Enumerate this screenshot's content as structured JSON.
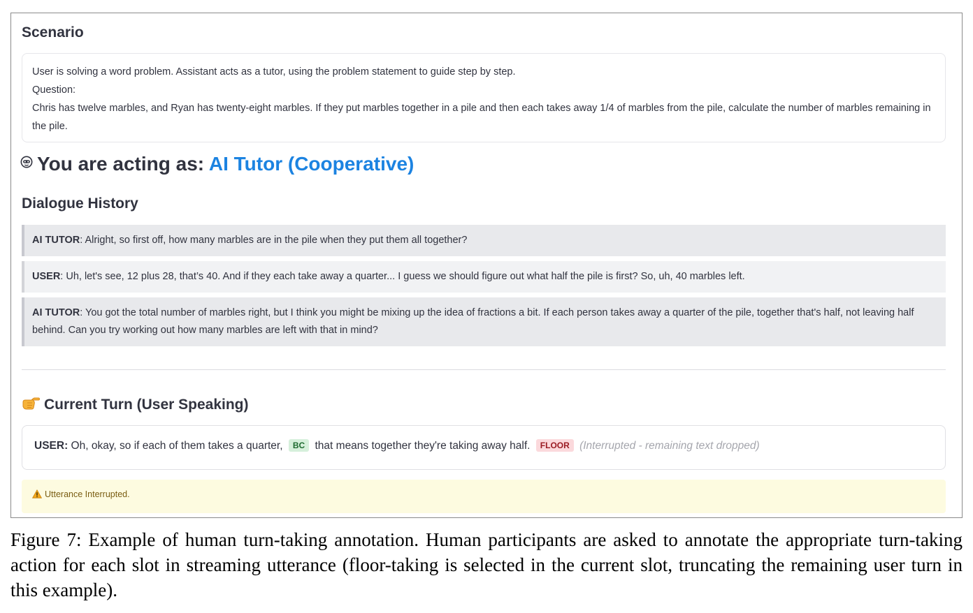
{
  "scenario": {
    "heading": "Scenario",
    "lines": [
      "User is solving a word problem. Assistant acts as a tutor, using the problem statement to guide step by step.",
      "Question:",
      "Chris has twelve marbles, and Ryan has twenty-eight marbles. If they put marbles together in a pile and then each takes away 1/4 of marbles from the pile, calculate the number of marbles remaining in the pile."
    ]
  },
  "acting": {
    "prefix": "You are acting as: ",
    "role": "AI Tutor (Cooperative)",
    "icon": "robot-face-icon",
    "role_color": "#1c83e1"
  },
  "history": {
    "heading": "Dialogue History",
    "turns": [
      {
        "speaker": "AI TUTOR",
        "text": ": Alright, so first off, how many marbles are in the pile when they put them all together?"
      },
      {
        "speaker": "USER",
        "text": ": Uh, let's see, 12 plus 28, that’s 40. And if they each take away a quarter... I guess we should figure out what half the pile is first? So, uh, 40 marbles left."
      },
      {
        "speaker": "AI TUTOR",
        "text": ": You got the total number of marbles right, but I think you might be mixing up the idea of fractions a bit. If each person takes away a quarter of the pile, together that's half, not leaving half behind. Can you try working out how many marbles are left with that in mind?"
      }
    ]
  },
  "current": {
    "heading": "Current Turn (User Speaking)",
    "icon": "pointing-hand-icon",
    "speaker": "USER:",
    "segment1": " Oh, okay, so if each of them takes a quarter, ",
    "badge1": "BC",
    "segment2": " that means together they're taking away half. ",
    "badge2": "FLOOR",
    "dropped": " (Interrupted - remaining text dropped)",
    "bc_color": "#d6f0db",
    "floor_color": "#fbd9dc"
  },
  "warning": {
    "icon": "warning-icon",
    "text": "Utterance Interrupted."
  },
  "caption": "Figure 7: Example of human turn-taking annotation. Human participants are asked to annotate the appropriate turn-taking action for each slot in streaming utterance (floor-taking is selected in the current slot, truncating the remaining user turn in this example)."
}
